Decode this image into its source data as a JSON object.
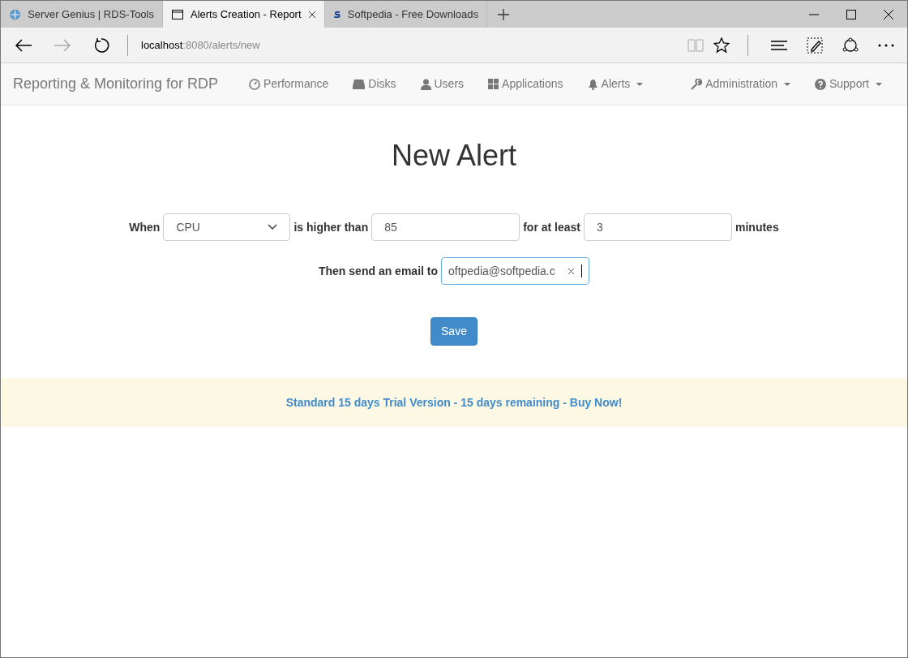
{
  "browser": {
    "tabs": [
      {
        "label": "Server Genius | RDS-Tools",
        "selected": false
      },
      {
        "label": "Alerts Creation - Report",
        "selected": true
      },
      {
        "label": "Softpedia - Free Downloads",
        "selected": false
      }
    ],
    "address": {
      "host": "localhost",
      "path": ":8080/alerts/new"
    }
  },
  "navbar": {
    "brand": "Reporting & Monitoring for RDP",
    "items": [
      {
        "label": "Performance",
        "dropdown": false
      },
      {
        "label": "Disks",
        "dropdown": false
      },
      {
        "label": "Users",
        "dropdown": false
      },
      {
        "label": "Applications",
        "dropdown": false
      },
      {
        "label": "Alerts",
        "dropdown": true
      }
    ],
    "right_items": [
      {
        "label": "Administration",
        "dropdown": true
      },
      {
        "label": "Support",
        "dropdown": true
      }
    ]
  },
  "heading": "New Alert",
  "form": {
    "when_label": "When",
    "metric": "CPU",
    "higher_label": "is higher than",
    "threshold": "85",
    "least_label": "for at least",
    "duration": "3",
    "minutes_label": "minutes",
    "email_label": "Then send an email to",
    "email": "oftpedia@softpedia.c"
  },
  "save_button": "Save",
  "trial_banner": "Standard 15 days Trial Version - 15 days remaining - Buy Now!"
}
